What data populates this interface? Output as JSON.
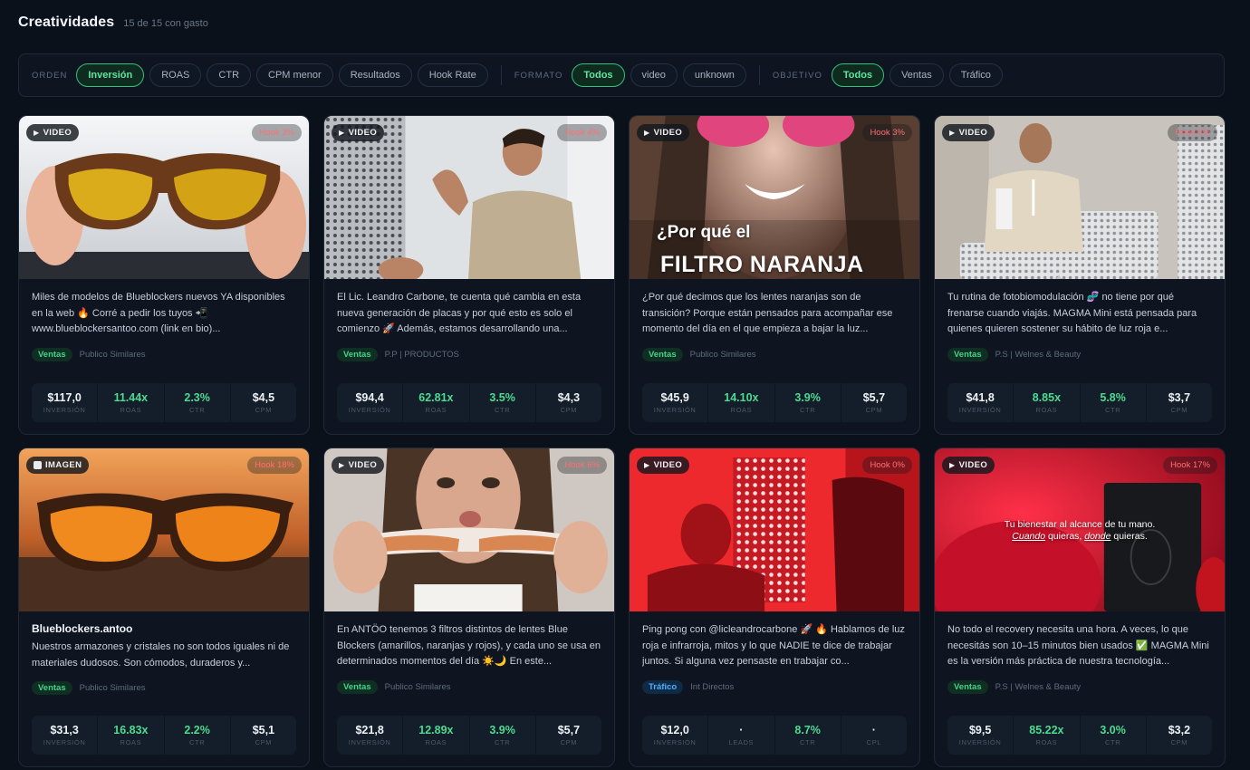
{
  "header": {
    "title": "Creatividades",
    "subtitle": "15 de 15 con gasto"
  },
  "filters": {
    "orden": {
      "label": "ORDEN",
      "options": [
        "Inversión",
        "ROAS",
        "CTR",
        "CPM menor",
        "Resultados",
        "Hook Rate"
      ],
      "active": "Inversión"
    },
    "formato": {
      "label": "FORMATO",
      "options": [
        "Todos",
        "video",
        "unknown"
      ],
      "active": "Todos"
    },
    "objetivo": {
      "label": "OBJETIVO",
      "options": [
        "Todos",
        "Ventas",
        "Tráfico"
      ],
      "active": "Todos"
    }
  },
  "colors": {
    "accent_green": "#42d28a",
    "accent_blue": "#4fb0ff",
    "hook_red": "#ff6f73",
    "background": "#0b111b"
  },
  "cards": [
    {
      "type": "VIDEO",
      "hook": "Hook 3%",
      "title": "",
      "overlay": [],
      "description": "Miles de modelos de Blueblockers nuevos YA disponibles en la web 🔥 Corré a pedir los tuyos 📲 www.blueblockersantoo.com (link en bio)...",
      "objective": "Ventas",
      "objective_color": "green",
      "audience": "Publico Similares",
      "metrics": [
        {
          "value": "$117,0",
          "label": "INVERSIÓN",
          "highlight": false
        },
        {
          "value": "11.44x",
          "label": "ROAS",
          "highlight": true
        },
        {
          "value": "2.3%",
          "label": "CTR",
          "highlight": true
        },
        {
          "value": "$4,5",
          "label": "CPM",
          "highlight": false
        }
      ]
    },
    {
      "type": "VIDEO",
      "hook": "Hook 4%",
      "title": "",
      "overlay": [],
      "description": "El Lic. Leandro Carbone, te cuenta qué cambia en esta nueva generación de placas y por qué esto es solo el comienzo 🚀 Además, estamos desarrollando una...",
      "objective": "Ventas",
      "objective_color": "green",
      "audience": "P.P | PRODUCTOS",
      "metrics": [
        {
          "value": "$94,4",
          "label": "INVERSIÓN",
          "highlight": false
        },
        {
          "value": "62.81x",
          "label": "ROAS",
          "highlight": true
        },
        {
          "value": "3.5%",
          "label": "CTR",
          "highlight": true
        },
        {
          "value": "$4,3",
          "label": "CPM",
          "highlight": false
        }
      ]
    },
    {
      "type": "VIDEO",
      "hook": "Hook 3%",
      "title": "",
      "overlay": [
        "¿Por qué el",
        "FILTRO NARANJA"
      ],
      "description": "¿Por qué decimos que los lentes naranjas son de transición? Porque están pensados para acompañar ese momento del día en el que empieza a bajar la luz...",
      "objective": "Ventas",
      "objective_color": "green",
      "audience": "Publico Similares",
      "metrics": [
        {
          "value": "$45,9",
          "label": "INVERSIÓN",
          "highlight": false
        },
        {
          "value": "14.10x",
          "label": "ROAS",
          "highlight": true
        },
        {
          "value": "3.9%",
          "label": "CTR",
          "highlight": true
        },
        {
          "value": "$5,7",
          "label": "CPM",
          "highlight": false
        }
      ]
    },
    {
      "type": "VIDEO",
      "hook": "Hook 8%",
      "title": "",
      "overlay": [],
      "description": "Tu rutina de fotobiomodulación 🧬 no tiene por qué frenarse cuando viajás. MAGMA Mini está pensada para quienes quieren sostener su hábito de luz roja e...",
      "objective": "Ventas",
      "objective_color": "green",
      "audience": "P.S | Welnes & Beauty",
      "metrics": [
        {
          "value": "$41,8",
          "label": "INVERSIÓN",
          "highlight": false
        },
        {
          "value": "8.85x",
          "label": "ROAS",
          "highlight": true
        },
        {
          "value": "5.8%",
          "label": "CTR",
          "highlight": true
        },
        {
          "value": "$3,7",
          "label": "CPM",
          "highlight": false
        }
      ]
    },
    {
      "type": "IMAGEN",
      "hook": "Hook 18%",
      "title": "Blueblockers.antoo",
      "overlay": [],
      "description": "Nuestros armazones y cristales no son todos iguales ni de materiales dudosos. Son cómodos, duraderos y...",
      "objective": "Ventas",
      "objective_color": "green",
      "audience": "Publico Similares",
      "metrics": [
        {
          "value": "$31,3",
          "label": "INVERSIÓN",
          "highlight": false
        },
        {
          "value": "16.83x",
          "label": "ROAS",
          "highlight": true
        },
        {
          "value": "2.2%",
          "label": "CTR",
          "highlight": true
        },
        {
          "value": "$5,1",
          "label": "CPM",
          "highlight": false
        }
      ]
    },
    {
      "type": "VIDEO",
      "hook": "Hook 6%",
      "title": "",
      "overlay": [],
      "description": "En ANTÖO tenemos 3 filtros distintos de lentes Blue Blockers (amarillos, naranjas y rojos), y cada uno se usa en determinados momentos del día ☀️🌙 En este...",
      "objective": "Ventas",
      "objective_color": "green",
      "audience": "Publico Similares",
      "metrics": [
        {
          "value": "$21,8",
          "label": "INVERSIÓN",
          "highlight": false
        },
        {
          "value": "12.89x",
          "label": "ROAS",
          "highlight": true
        },
        {
          "value": "3.9%",
          "label": "CTR",
          "highlight": true
        },
        {
          "value": "$5,7",
          "label": "CPM",
          "highlight": false
        }
      ]
    },
    {
      "type": "VIDEO",
      "hook": "Hook 0%",
      "title": "",
      "overlay": [],
      "description": "Ping pong con @licleandrocarbone 🚀 🔥 Hablamos de luz roja e infrarroja, mitos y lo que NADIE te dice de trabajar juntos. Si alguna vez pensaste en trabajar co...",
      "objective": "Tráfico",
      "objective_color": "blue",
      "audience": "Int Directos",
      "metrics": [
        {
          "value": "$12,0",
          "label": "INVERSIÓN",
          "highlight": false
        },
        {
          "value": "·",
          "label": "LEADS",
          "highlight": false
        },
        {
          "value": "8.7%",
          "label": "CTR",
          "highlight": true
        },
        {
          "value": "·",
          "label": "CPL",
          "highlight": false
        }
      ]
    },
    {
      "type": "VIDEO",
      "hook": "Hook 17%",
      "title": "",
      "overlay": [
        "Tu bienestar al alcance de tu mano.",
        "Cuando",
        "quieras,",
        "donde",
        "quieras."
      ],
      "description": "No todo el recovery necesita una hora. A veces, lo que necesitás son 10–15 minutos bien usados ✅ MAGMA Mini es la versión más práctica de nuestra tecnología...",
      "objective": "Ventas",
      "objective_color": "green",
      "audience": "P.S | Welnes & Beauty",
      "metrics": [
        {
          "value": "$9,5",
          "label": "INVERSIÓN",
          "highlight": false
        },
        {
          "value": "85.22x",
          "label": "ROAS",
          "highlight": true
        },
        {
          "value": "3.0%",
          "label": "CTR",
          "highlight": true
        },
        {
          "value": "$3,2",
          "label": "CPM",
          "highlight": false
        }
      ]
    }
  ]
}
